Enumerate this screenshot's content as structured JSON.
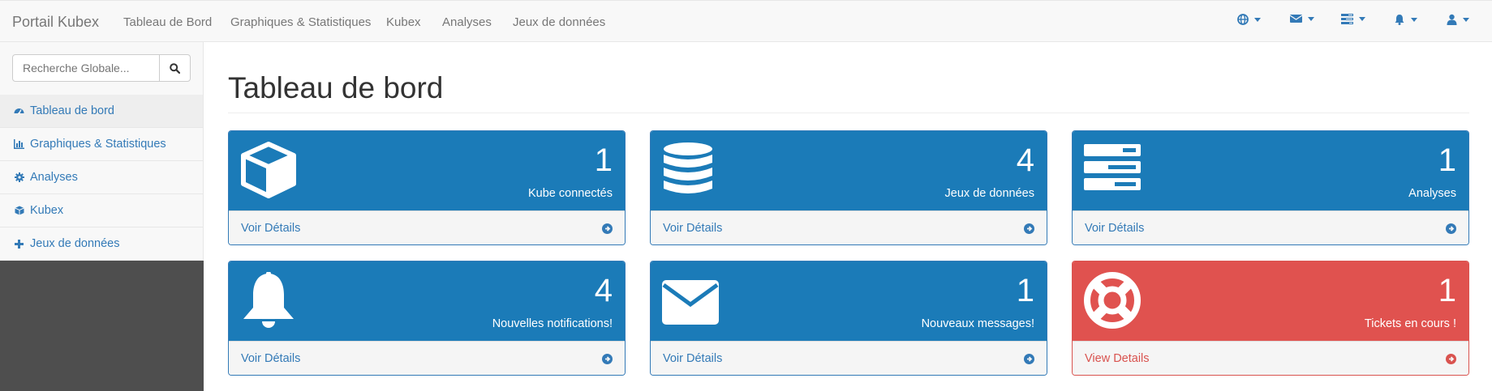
{
  "navbar": {
    "brand": "Portail Kubex",
    "links": [
      "Tableau de Bord",
      "Graphiques & Statistiques",
      "Kubex",
      "Analyses",
      "Jeux de données"
    ],
    "right_icons": [
      "globe-icon",
      "envelope-icon",
      "tasks-icon",
      "bell-icon",
      "user-icon"
    ]
  },
  "sidebar": {
    "search_placeholder": "Recherche Globale...",
    "items": [
      {
        "label": "Tableau de bord",
        "icon": "dashboard-icon",
        "active": true
      },
      {
        "label": "Graphiques & Statistiques",
        "icon": "bar-chart-icon",
        "active": false
      },
      {
        "label": "Analyses",
        "icon": "gear-icon",
        "active": false
      },
      {
        "label": "Kubex",
        "icon": "cube-icon",
        "active": false
      },
      {
        "label": "Jeux de données",
        "icon": "plus-icon",
        "active": false
      }
    ]
  },
  "main": {
    "title": "Tableau de bord",
    "panels": [
      {
        "count": "1",
        "label": "Kube connectés",
        "link": "Voir Détails",
        "icon": "cube-icon",
        "color": "#1b7bb8"
      },
      {
        "count": "4",
        "label": "Jeux de données",
        "link": "Voir Détails",
        "icon": "database-icon",
        "color": "#1b7bb8"
      },
      {
        "count": "1",
        "label": "Analyses",
        "link": "Voir Détails",
        "icon": "server-icon",
        "color": "#1b7bb8"
      },
      {
        "count": "4",
        "label": "Nouvelles notifications!",
        "link": "Voir Détails",
        "icon": "bell-icon",
        "color": "#1b7bb8"
      },
      {
        "count": "1",
        "label": "Nouveaux messages!",
        "link": "Voir Détails",
        "icon": "envelope-icon",
        "color": "#1b7bb8"
      },
      {
        "count": "1",
        "label": "Tickets en cours !",
        "link": "View Details",
        "icon": "life-ring-icon",
        "color": "#e0524f"
      }
    ]
  },
  "colors": {
    "primary": "#337ab7",
    "panel_blue": "#1b7bb8",
    "danger": "#e0524f"
  }
}
